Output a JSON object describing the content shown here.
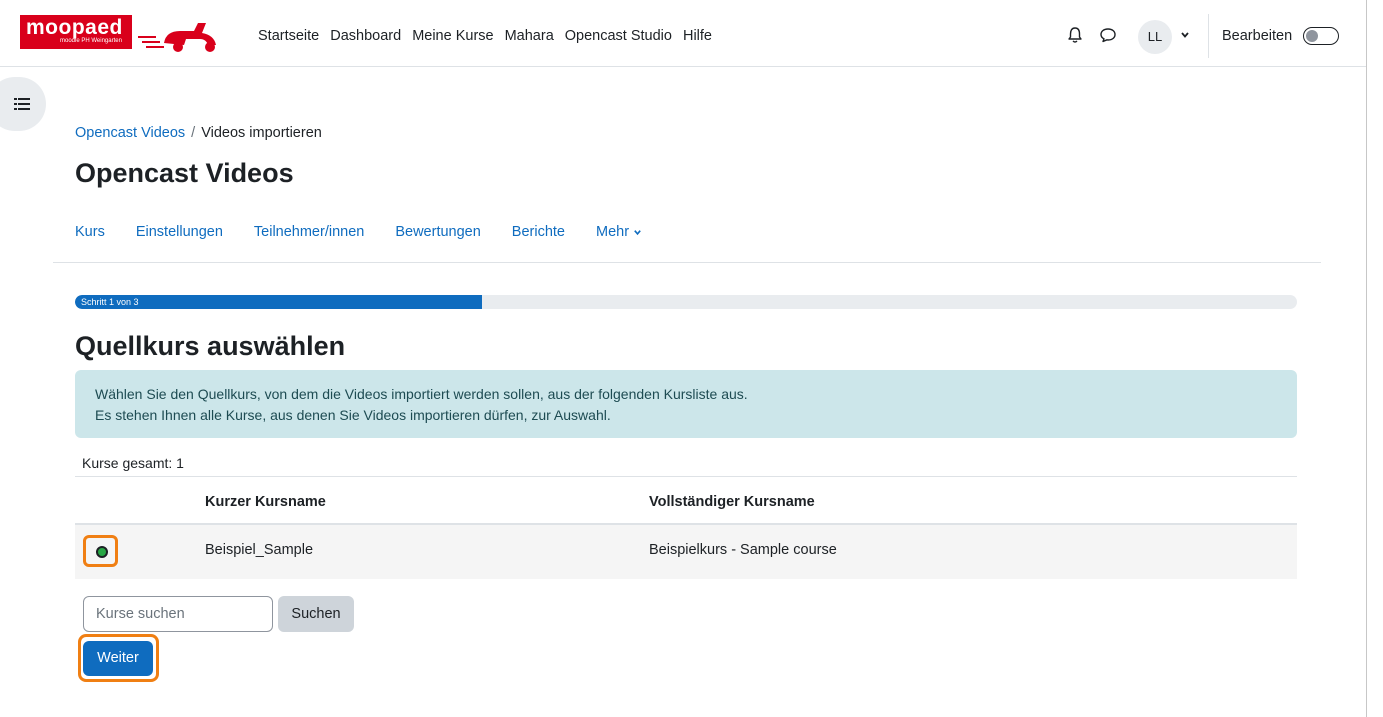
{
  "brand": {
    "logo_text": "moopaed",
    "logo_subtext": "moodle PH Weingarten",
    "accent_color": "#d9001b"
  },
  "topnav": {
    "items": [
      "Startseite",
      "Dashboard",
      "Meine Kurse",
      "Mahara",
      "Opencast Studio",
      "Hilfe"
    ],
    "user_initials": "LL",
    "edit_mode_label": "Bearbeiten",
    "edit_mode_on": false
  },
  "breadcrumb": {
    "parent": "Opencast Videos",
    "separator": "/",
    "current": "Videos importieren"
  },
  "page": {
    "title": "Opencast Videos"
  },
  "secondary_nav": {
    "items": [
      "Kurs",
      "Einstellungen",
      "Teilnehmer/innen",
      "Bewertungen",
      "Berichte"
    ],
    "more_label": "Mehr"
  },
  "wizard": {
    "step_label": "Schritt 1 von 3",
    "progress_fraction": 0.333,
    "step_title": "Quellkurs auswählen",
    "info_line1": "Wählen Sie den Quellkurs, von dem die Videos importiert werden sollen, aus der folgenden Kursliste aus.",
    "info_line2": "Es stehen Ihnen alle Kurse, aus denen Sie Videos importieren dürfen, zur Auswahl."
  },
  "courses": {
    "count_label": "Kurse gesamt: 1",
    "columns": [
      "Kurzer Kursname",
      "Vollständiger Kursname"
    ],
    "rows": [
      {
        "short": "Beispiel_Sample",
        "full": "Beispielkurs - Sample course",
        "selected": true
      }
    ]
  },
  "search": {
    "placeholder": "Kurse suchen",
    "button_label": "Suchen"
  },
  "actions": {
    "next_label": "Weiter"
  },
  "colors": {
    "primary": "#0f6cbf",
    "highlight": "#f07f13",
    "info_bg": "#cce6ea"
  }
}
